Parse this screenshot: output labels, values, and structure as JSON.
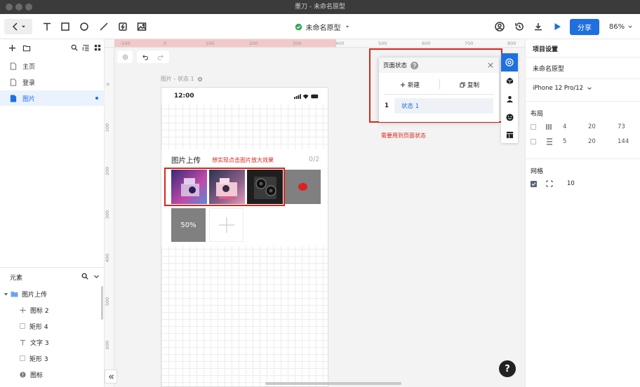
{
  "window": {
    "title": "墨刀 - 未命名原型"
  },
  "toolbar": {
    "project_name": "未命名原型",
    "share_label": "分享",
    "zoom": "86%"
  },
  "pages": {
    "items": [
      {
        "label": "主页"
      },
      {
        "label": "登录"
      },
      {
        "label": "图片"
      }
    ]
  },
  "elements": {
    "title": "元素",
    "items": [
      {
        "label": "图片上传"
      },
      {
        "label": "图标 2"
      },
      {
        "label": "矩形 4"
      },
      {
        "label": "文字 3"
      },
      {
        "label": "矩形 3"
      },
      {
        "label": "图标"
      }
    ]
  },
  "canvas": {
    "ruler_top": [
      "-100",
      "0",
      "100",
      "200",
      "300",
      "400",
      "500",
      "600",
      "700",
      "800"
    ],
    "ruler_left": [
      "0",
      "100",
      "200",
      "300",
      "400",
      "500",
      "600"
    ],
    "frame_label": "图片 - 状态 1",
    "status_time": "12:00",
    "upload_title": "图片上传",
    "upload_count": "0/2",
    "annotation_zoom": "想实现点击图片放大效果",
    "progress_label": "50%",
    "annotation_state": "需要用到页面状态"
  },
  "state_popup": {
    "title": "页面状态",
    "new_label": "新建",
    "copy_label": "复制",
    "row_index": "1",
    "row_label": "状态 1"
  },
  "project_settings": {
    "title": "项目设置",
    "project_name": "未命名原型",
    "device": "iPhone 12 Pro/12",
    "layout_title": "布局",
    "layout_rows": [
      {
        "a": "4",
        "b": "20",
        "c": "73"
      },
      {
        "a": "5",
        "b": "20",
        "c": "144"
      }
    ],
    "grid_title": "网格",
    "grid_value": "10"
  },
  "colors": {
    "accent": "#1f6fe0",
    "annotation": "#d9261c"
  }
}
